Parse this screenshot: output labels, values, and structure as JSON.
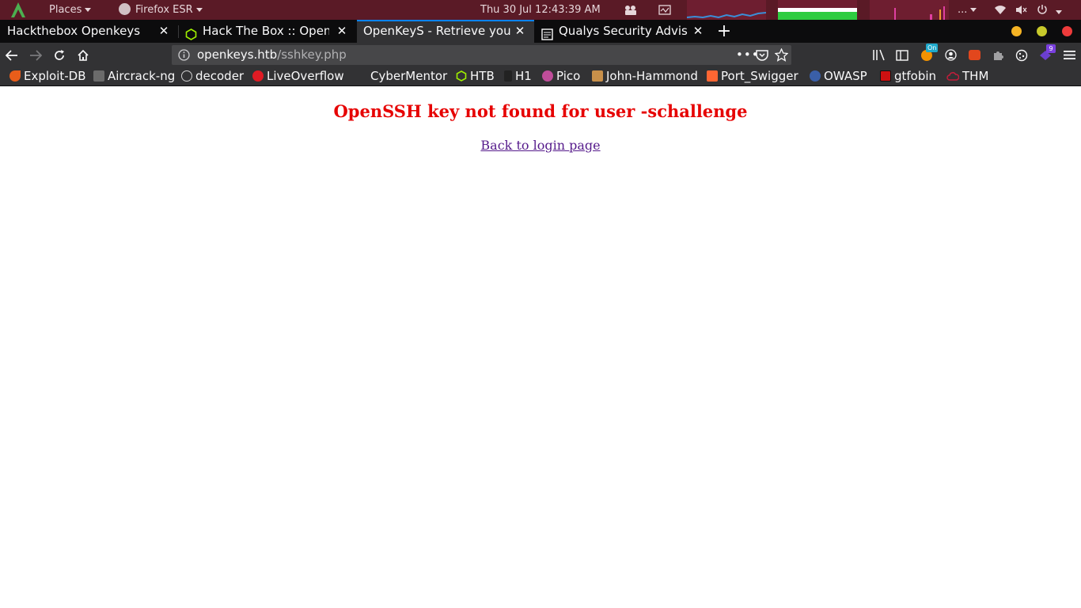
{
  "system_panel": {
    "places_label": "Places",
    "firefox_label": "Firefox ESR",
    "clock": "Thu 30 Jul  12:43:39 AM",
    "more_label": "..."
  },
  "tabs": [
    {
      "title": "Hackthebox Openkeys",
      "selected": false
    },
    {
      "title": "Hack The Box :: OpenKeys",
      "selected": false
    },
    {
      "title": "OpenKeyS - Retrieve your OpenSSH Key",
      "selected": true
    },
    {
      "title": "Qualys Security Advisory",
      "selected": false
    }
  ],
  "navbar": {
    "url_host": "openkeys.htb",
    "url_path": "/sshkey.php",
    "ext_badge_on": "On",
    "ext_badge_count": "9"
  },
  "bookmarks": [
    {
      "label": "Exploit-DB",
      "color": "#e85d1a"
    },
    {
      "label": "Aircrack-ng",
      "color": "#6b6b6b"
    },
    {
      "label": "decoder",
      "color": "#cfcfcf"
    },
    {
      "label": "LiveOverflow",
      "color": "#e01b24"
    },
    {
      "label": "CyberMentor",
      "color": ""
    },
    {
      "label": "HTB",
      "color": "#9fef00"
    },
    {
      "label": "H1",
      "color": "#222222"
    },
    {
      "label": "Pico",
      "color": "#c04d9a"
    },
    {
      "label": "John-Hammond",
      "color": "#c8904a"
    },
    {
      "label": "Port_Swigger",
      "color": "#ff6633"
    },
    {
      "label": "OWASP",
      "color": "#3a5fa8"
    },
    {
      "label": "gtfobin",
      "color": "#cc1111"
    },
    {
      "label": "THM",
      "color": "#c21d3b"
    }
  ],
  "page": {
    "error_message": "OpenSSH key not found for user -schallenge",
    "back_link": "Back to login page"
  },
  "colors": {
    "panel": "#5a1a26",
    "tab_accent": "#0a84ff",
    "error": "#e60000",
    "link": "#551a8b"
  }
}
